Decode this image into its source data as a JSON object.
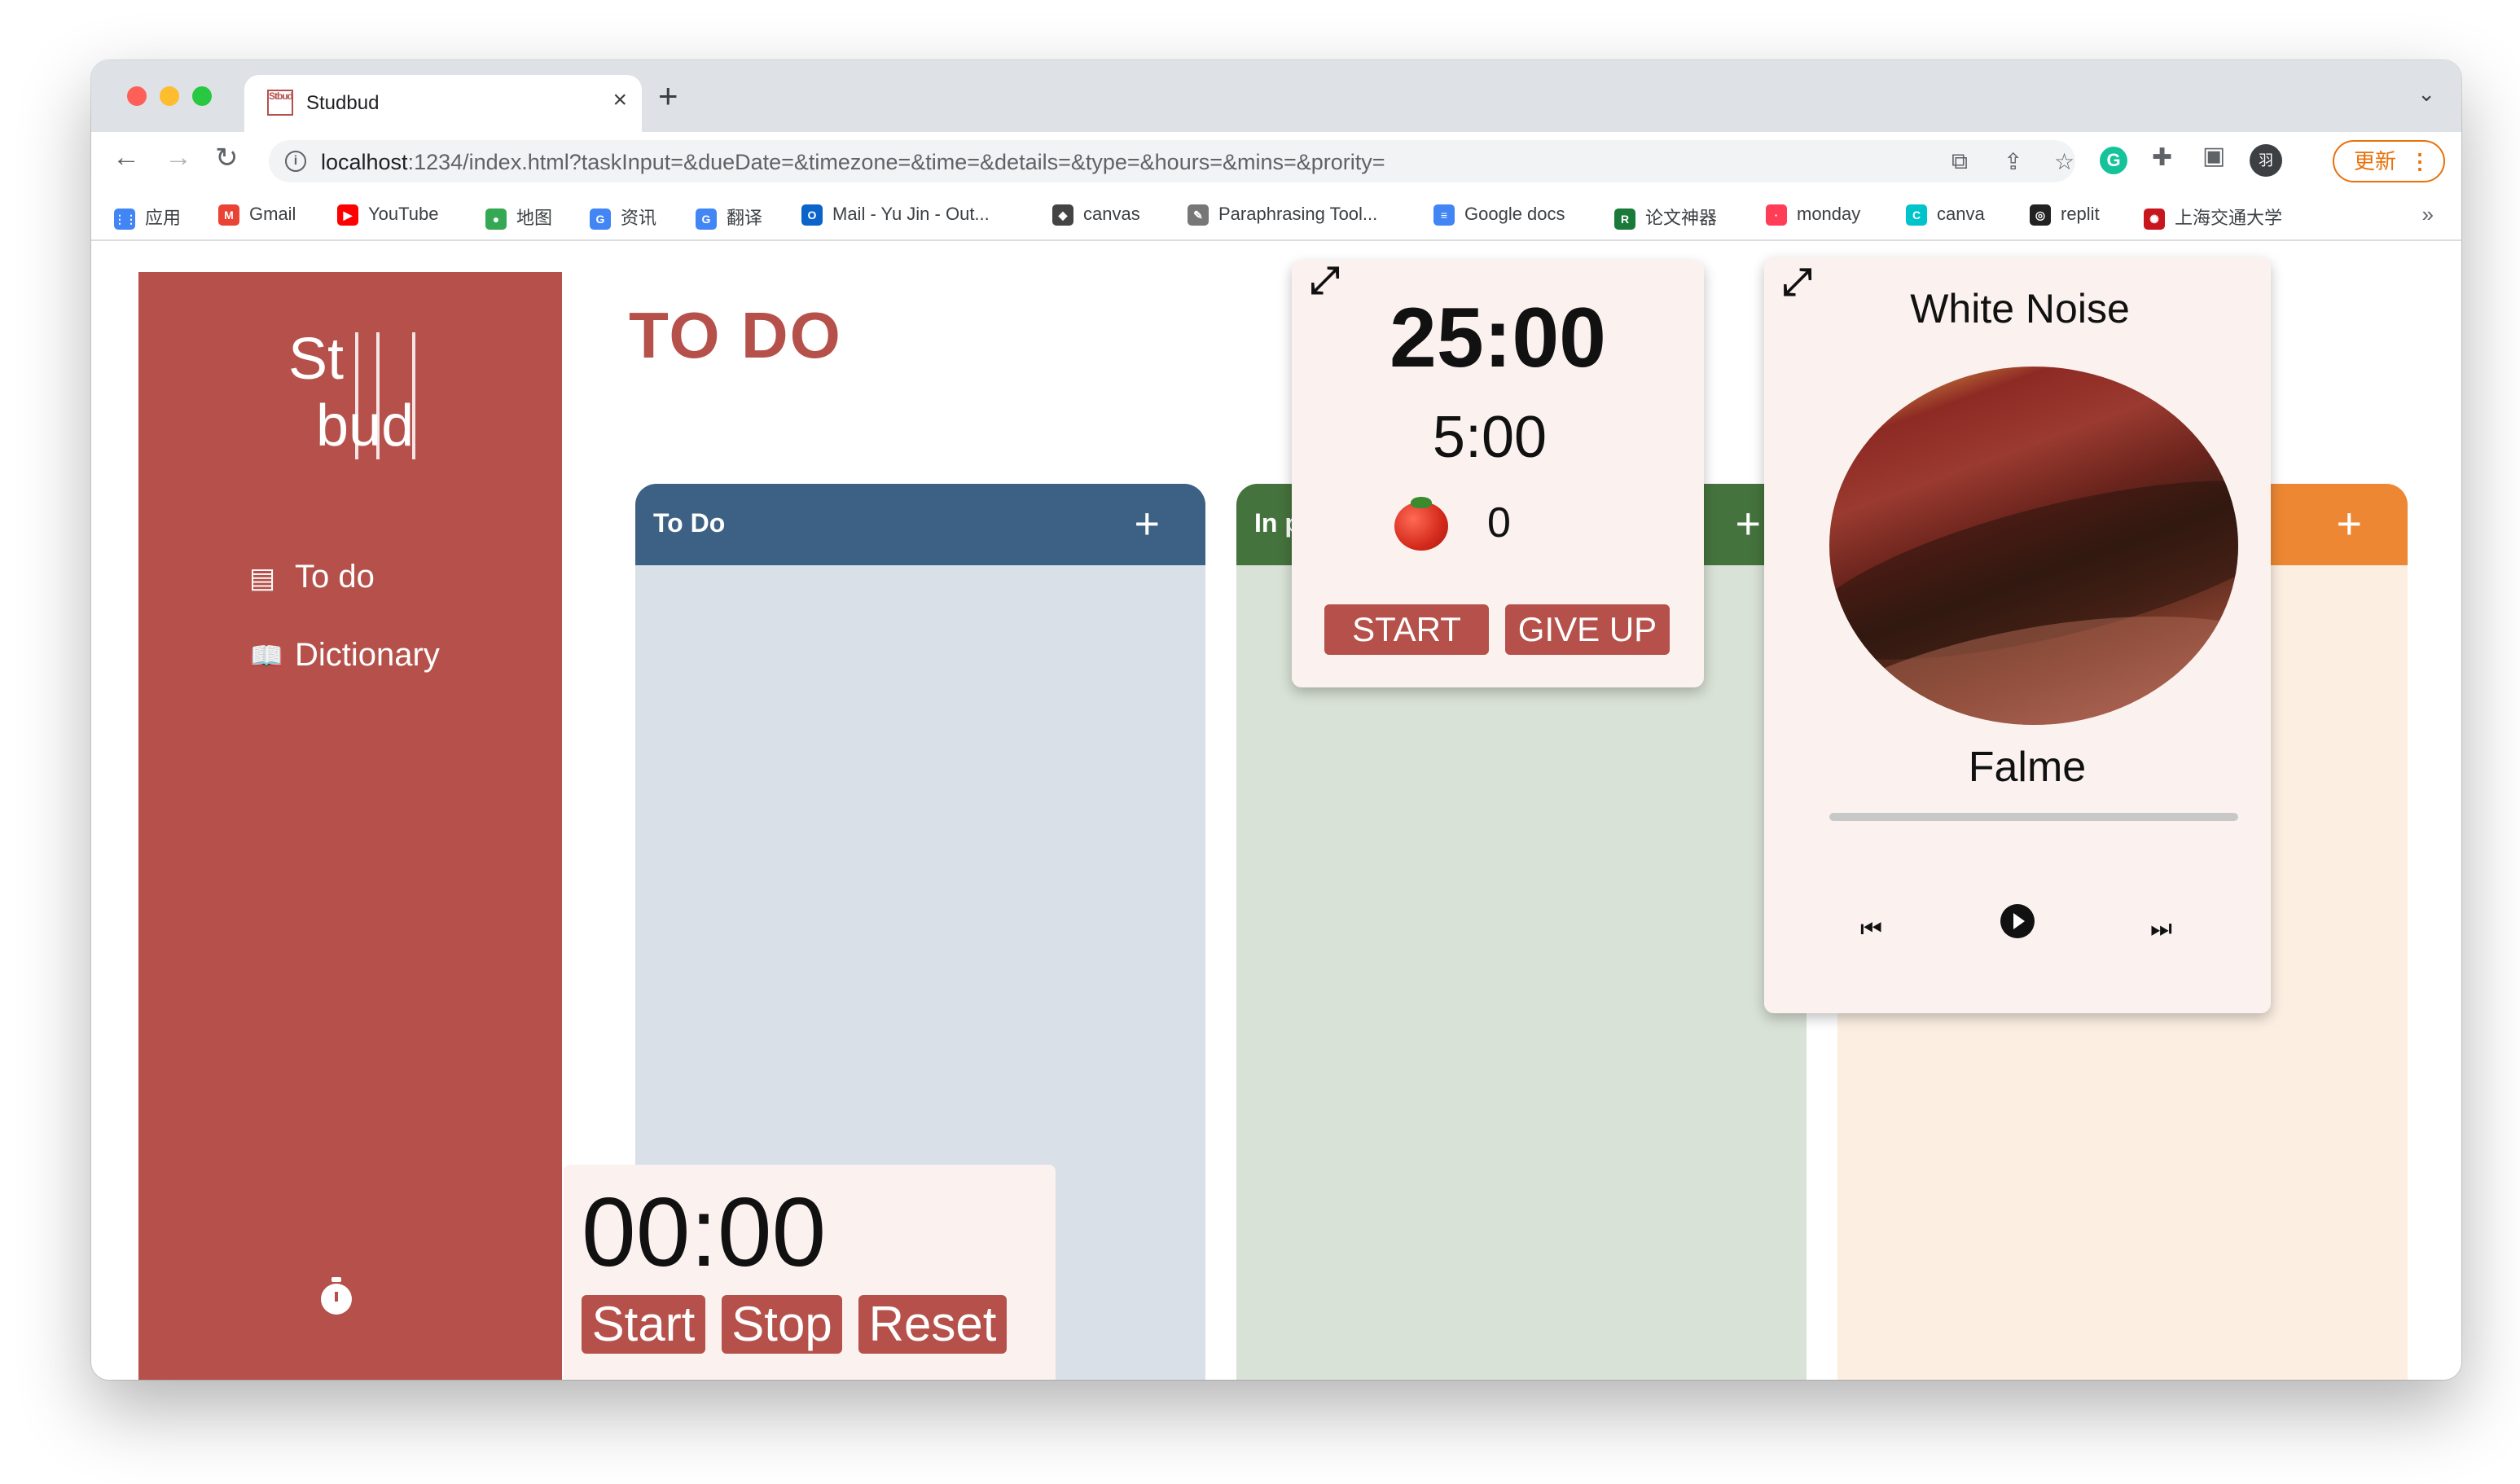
{
  "browser": {
    "tab_title": "Studbud",
    "tab_favicon": "Stbud",
    "tab_close": "×",
    "new_tab": "+",
    "url_host": "localhost",
    "url_rest": ":1234/index.html?taskInput=&dueDate=&timezone=&time=&details=&type=&hours=&mins=&prority=",
    "update_label": "更新",
    "update_menu": "⋮",
    "profile_initial": "羽",
    "bookmarks": [
      {
        "label": "应用",
        "icon": "apps-grid-icon",
        "color": "#4285f4",
        "glyph": "⋮⋮"
      },
      {
        "label": "Gmail",
        "icon": "gmail-icon",
        "color": "#ea4335",
        "glyph": "M"
      },
      {
        "label": "YouTube",
        "icon": "youtube-icon",
        "color": "#ff0000",
        "glyph": "▶"
      },
      {
        "label": "地图",
        "icon": "maps-icon",
        "color": "#34a853",
        "glyph": "●"
      },
      {
        "label": "资讯",
        "icon": "news-icon",
        "color": "#4285f4",
        "glyph": "G"
      },
      {
        "label": "翻译",
        "icon": "translate-icon",
        "color": "#4285f4",
        "glyph": "G"
      },
      {
        "label": "Mail - Yu Jin - Out...",
        "icon": "outlook-icon",
        "color": "#0a64c9",
        "glyph": "O"
      },
      {
        "label": "canvas",
        "icon": "canvas-crest-icon",
        "color": "#444444",
        "glyph": "◆"
      },
      {
        "label": "Paraphrasing Tool...",
        "icon": "quill-icon",
        "color": "#777777",
        "glyph": "✎"
      },
      {
        "label": "Google docs",
        "icon": "docs-icon",
        "color": "#4285f4",
        "glyph": "≡"
      },
      {
        "label": "论文神器",
        "icon": "pr-icon",
        "color": "#1a7a3a",
        "glyph": "R"
      },
      {
        "label": "monday",
        "icon": "monday-icon",
        "color": "#ff3d57",
        "glyph": "·"
      },
      {
        "label": "canva",
        "icon": "canva-icon",
        "color": "#00c4cc",
        "glyph": "C"
      },
      {
        "label": "replit",
        "icon": "replit-icon",
        "color": "#222222",
        "glyph": "◎"
      },
      {
        "label": "上海交通大学",
        "icon": "sjtu-icon",
        "color": "#c8161e",
        "glyph": "✺"
      }
    ],
    "bookmarks_more": "»"
  },
  "sidebar": {
    "logo_line1": "St",
    "logo_line2": "bud",
    "items": [
      {
        "label": "To do",
        "icon": "list-icon",
        "glyph": "▤"
      },
      {
        "label": "Dictionary",
        "icon": "book-icon",
        "glyph": "📖"
      }
    ]
  },
  "page": {
    "title": "TO DO"
  },
  "columns": [
    {
      "title": "To Do",
      "add": "+"
    },
    {
      "title": "In p",
      "add": "+"
    },
    {
      "title": "",
      "add": "+"
    }
  ],
  "pomodoro": {
    "work_time": "25:00",
    "break_time": "5:00",
    "count": "0",
    "start_label": "START",
    "giveup_label": "GIVE UP"
  },
  "white_noise": {
    "title": "White Noise",
    "track": "Falme",
    "progress": 0
  },
  "stopwatch": {
    "time": "00:00",
    "start_label": "Start",
    "stop_label": "Stop",
    "reset_label": "Reset"
  },
  "colors": {
    "brand": "#b5514a",
    "todo_header": "#3c6184",
    "progress_header": "#45733d",
    "done_header": "#ed8733"
  }
}
